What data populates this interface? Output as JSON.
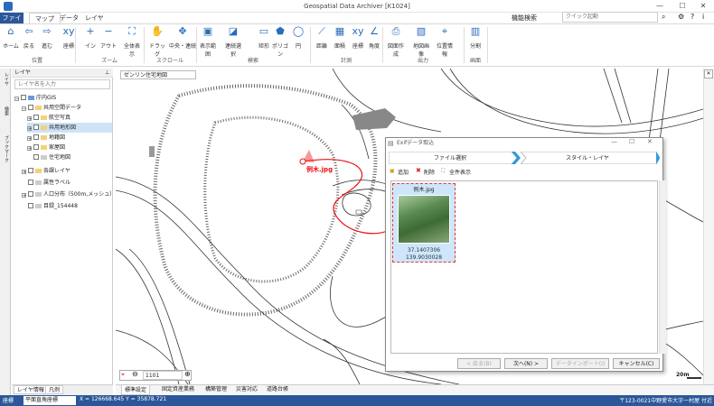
{
  "window": {
    "title": "Geospatial Data Archiver [K1024]",
    "min": "—",
    "max": "☐",
    "close": "✕"
  },
  "tabs": [
    "ファイル",
    "マップ",
    "データ",
    "レイヤ"
  ],
  "search": {
    "label": "機能検索",
    "placeholder": "クイック起動"
  },
  "ribbon": {
    "buttons": [
      "ホーム",
      "戻る",
      "進む",
      "座標",
      "イン",
      "アウト",
      "全体表示",
      "ドラッグ",
      "中央・連続",
      "表示範囲",
      "連続選択",
      "矩形",
      "ポリゴン",
      "円",
      "距離",
      "面積",
      "座標",
      "角度",
      "図面作成",
      "地図画像",
      "位置情報",
      "分割"
    ],
    "groups": [
      "位置",
      "ズーム",
      "スクロール",
      "検索",
      "計測",
      "出力",
      "画面"
    ]
  },
  "rail": [
    "レイヤ",
    "検索",
    "ブックマーク"
  ],
  "layer_panel": {
    "title": "レイヤ",
    "search_placeholder": "レイヤ名を入力",
    "tree": [
      "庁内GIS",
      "共用空間データ",
      "航空写真",
      "共用地形図",
      "地籍図",
      "家屋図",
      "住宅地図",
      "各課レイヤ",
      "属性ラベル",
      "人口分布（500m,メッシュ）",
      "目録_154448"
    ],
    "tabs": [
      "レイヤ情報",
      "凡例"
    ]
  },
  "map": {
    "tab": "ゼンリン住宅地図",
    "marker_label": "例木.jpg",
    "scale_value": "1101",
    "scale_text": "20m"
  },
  "dialog": {
    "title": "Exifデータ取込",
    "steps": [
      "ファイル選択",
      "スタイル・レイヤ"
    ],
    "toolbar": [
      "追加",
      "削除",
      "全件表示"
    ],
    "item": {
      "name": "例木.jpg",
      "lat": "37.1407306",
      "lon": "139.9030028"
    },
    "buttons": [
      "< 戻る(B)",
      "次へ(N) >",
      "データインポート(I)",
      "キャンセル(C)"
    ]
  },
  "bottom_tabs": [
    "標準設定",
    "固定資産業務",
    "構築管理",
    "災害対応",
    "道路台帳"
  ],
  "status": {
    "mode": "座標",
    "crs": "平面直角座標",
    "coords": "X = 126668.645  Y = 35878.721",
    "address": "〒123-0021中野愛市大字一村屋 付近"
  }
}
